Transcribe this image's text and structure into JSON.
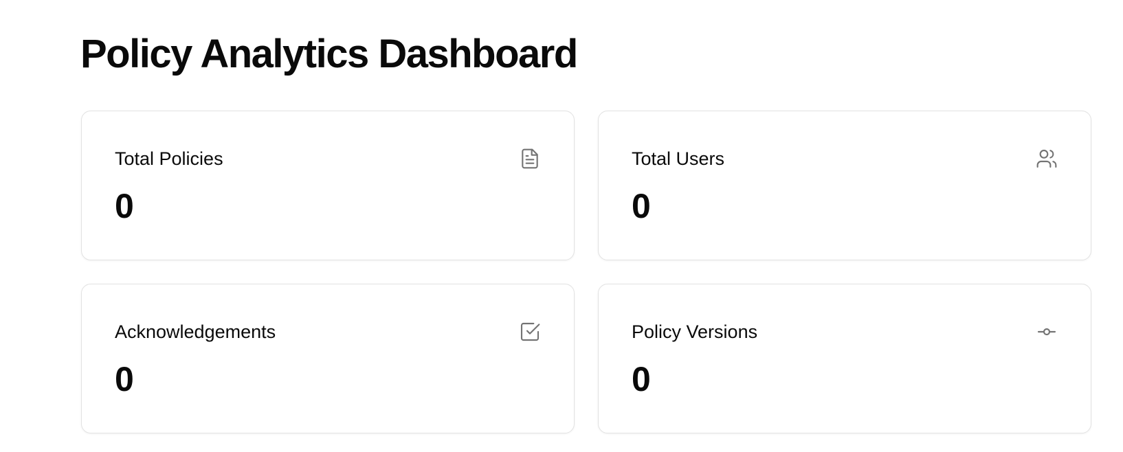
{
  "header": {
    "title": "Policy Analytics Dashboard"
  },
  "stats": [
    {
      "label": "Total Policies",
      "value": "0",
      "icon": "file-text-icon"
    },
    {
      "label": "Total Users",
      "value": "0",
      "icon": "users-icon"
    },
    {
      "label": "Acknowledgements",
      "value": "0",
      "icon": "check-square-icon"
    },
    {
      "label": "Policy Versions",
      "value": "0",
      "icon": "git-commit-icon"
    }
  ],
  "colors": {
    "text": "#0a0a0a",
    "icon": "#737373",
    "card_border": "#e2e2e2",
    "background": "#ffffff"
  }
}
